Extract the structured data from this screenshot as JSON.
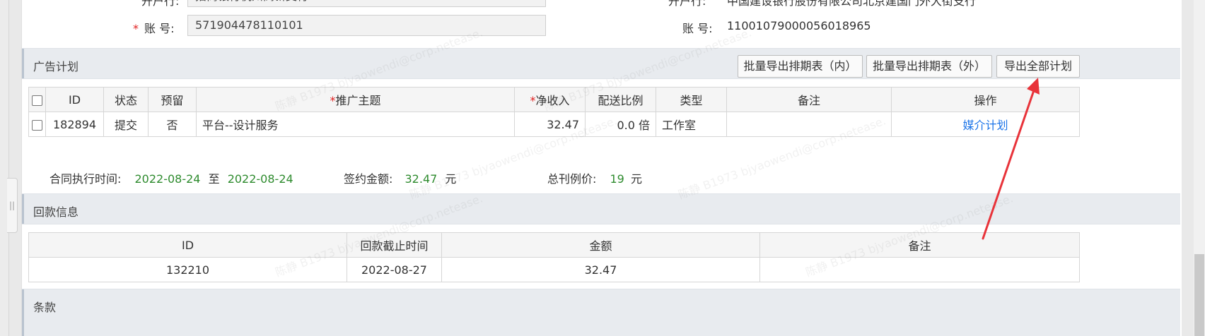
{
  "account_section": {
    "bank_label_left": "开户行:",
    "bank_value_left": "招商银行杭州高新支行",
    "bank_label_right": "开户行:",
    "bank_value_right": "中国建设银行股份有限公司北京建国门外大街支行",
    "account_required_mark": "*",
    "account_label_left": "账 号:",
    "account_value_left": "571904478110101",
    "account_label_right": "账 号:",
    "account_value_right": "11001079000056018965"
  },
  "ad_plan": {
    "title": "广告计划",
    "buttons": {
      "export_schedule_in": "批量导出排期表（内）",
      "export_schedule_out": "批量导出排期表（外）",
      "export_all": "导出全部计划"
    },
    "columns": {
      "id": "ID",
      "status": "状态",
      "reserved": "预留",
      "topic_star": "*",
      "topic": "推广主题",
      "net_star": "*",
      "net_income": "净收入",
      "ratio": "配送比例",
      "type": "类型",
      "note": "备注",
      "action": "操作"
    },
    "rows": [
      {
        "id": "182894",
        "status": "提交",
        "reserved": "否",
        "topic": "平台--设计服务",
        "net_income": "32.47",
        "ratio": "0.0 倍",
        "type": "工作室",
        "note": "",
        "action": "媒介计划"
      }
    ]
  },
  "contract_info": {
    "period_label": "合同执行时间:",
    "start_date": "2022-08-24",
    "to": "至",
    "end_date": "2022-08-24",
    "amount_label": "签约金额:",
    "amount_value": "32.47",
    "amount_unit": "元",
    "list_price_label": "总刊例价:",
    "list_price_value": "19",
    "list_price_unit": "元"
  },
  "payment_info": {
    "title": "回款信息",
    "columns": {
      "id": "ID",
      "deadline": "回款截止时间",
      "amount": "金额",
      "note": "备注"
    },
    "rows": [
      {
        "id": "132210",
        "deadline": "2022-08-27",
        "amount": "32.47",
        "note": ""
      }
    ]
  },
  "terms": {
    "title": "条款"
  },
  "watermark": {
    "name": "陈静 B1973",
    "email": "bjyaowendi@corp.netease.",
    "suffix": "com"
  },
  "colors": {
    "accent_arrow": "#e8333a",
    "link": "#1a73e8",
    "value_green": "#2e8b2e",
    "section_bg": "#e8ebef"
  }
}
